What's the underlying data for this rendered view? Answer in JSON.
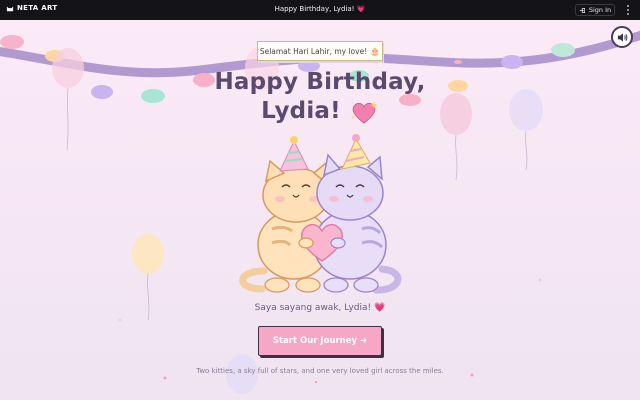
{
  "topbar": {
    "brand": "NETA ART",
    "title": "Happy Birthday, Lydia! 💗",
    "signin_label": "Sign In"
  },
  "note": {
    "text": "Selamat Hari Lahir, my love!",
    "emoji": "🎂"
  },
  "headline": {
    "line1": "Happy Birthday,",
    "line2": "Lydia!"
  },
  "message": {
    "text": "Saya sayang awak, Lydia!",
    "emoji": "💗"
  },
  "cta": {
    "label": "Start Our Journey",
    "arrow": "➜"
  },
  "tagline": "Two kitties, a sky full of stars, and one very loved girl across the miles.",
  "icons": {
    "brand": "cat-logo-icon",
    "signin": "login-icon",
    "menu": "vertical-dots-icon",
    "sound": "speaker-icon"
  },
  "colors": {
    "topbar": "#141317",
    "accent_pink": "#f7a7c6",
    "title_purple": "#5a4a6e",
    "garland": "#9d86c4"
  }
}
